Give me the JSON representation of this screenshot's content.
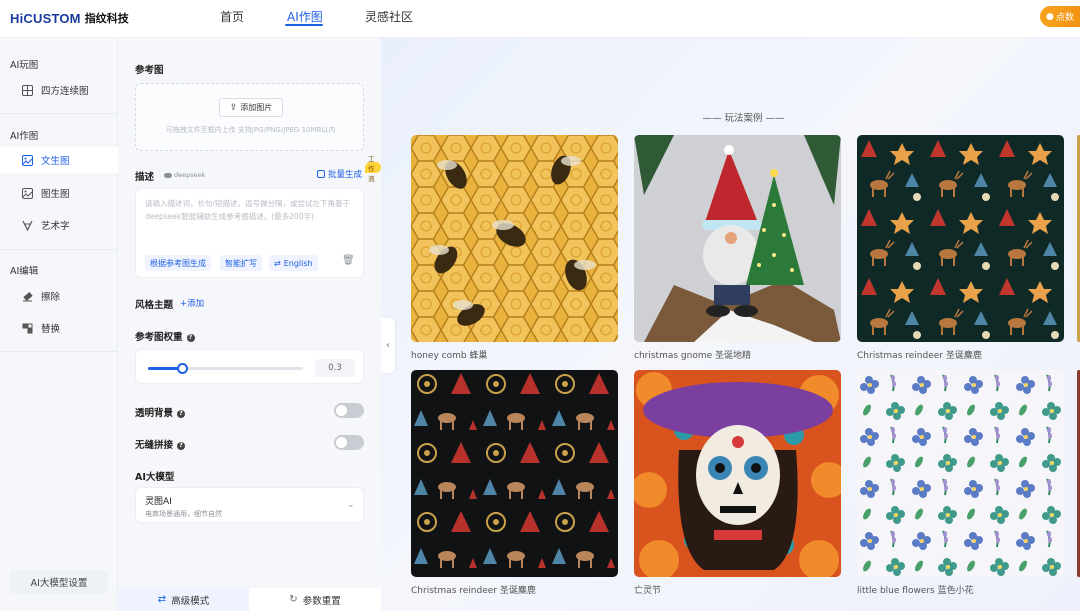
{
  "header": {
    "logo_en": "HiCUSTOM",
    "logo_cn": "指纹科技",
    "nav": [
      {
        "label": "首页",
        "active": false
      },
      {
        "label": "AI作图",
        "active": true
      },
      {
        "label": "灵感社区",
        "active": false
      }
    ],
    "points_label": "点数"
  },
  "sidebar": {
    "sections": [
      {
        "title": "AI玩图",
        "items": [
          {
            "label": "四方连续图",
            "icon": "grid-icon",
            "active": false
          }
        ]
      },
      {
        "title": "AI作图",
        "items": [
          {
            "label": "文生图",
            "icon": "image-text-icon",
            "active": true
          },
          {
            "label": "图生图",
            "icon": "image-icon",
            "active": false
          },
          {
            "label": "艺术字",
            "icon": "text-art-icon",
            "active": false
          }
        ]
      },
      {
        "title": "AI编辑",
        "items": [
          {
            "label": "擦除",
            "icon": "eraser-icon",
            "active": false
          },
          {
            "label": "替换",
            "icon": "replace-icon",
            "active": false
          }
        ]
      }
    ],
    "model_settings_label": "AI大模型设置"
  },
  "form": {
    "reference_image_label": "参考图",
    "upload_button": "添加图片",
    "upload_hint": "可拖拽文件至框内上传 支持JPG/PNG/JPEG 10MB以内",
    "description_label": "描述",
    "deepseek_label": "deepseek",
    "batch_label": "批量生成",
    "workflow_badge": "工作流",
    "description_placeholder": "请输入描述词，长句/短描述，逗号做分隔，或尝试左下角基于deepseek智能辅助生成参考图描述。(最多200字)",
    "chips": {
      "from_reference": "根据参考图生成",
      "smart_expand": "智能扩写",
      "english": "English"
    },
    "style_label": "风格主题",
    "add_label": "添加",
    "weight_label": "参考图权重",
    "weight_value": "0.3",
    "weight_fraction": 0.22,
    "transparent_label": "透明背景",
    "transparent_on": false,
    "seamless_label": "无缝拼接",
    "seamless_on": false,
    "model_label": "AI大模型",
    "model_name": "灵图AI",
    "model_desc": "电商场景通用，细节自然",
    "advanced_label": "高级模式",
    "reset_label": "参数重置"
  },
  "gallery": {
    "title": "—— 玩法案例 ——",
    "cards": [
      {
        "caption": "honey comb 蜂巢",
        "pattern": "honeycomb"
      },
      {
        "caption": "christmas gnome 圣诞地精",
        "pattern": "gnome"
      },
      {
        "caption": "Christmas reindeer 圣诞麋鹿",
        "pattern": "reindeer-dark"
      },
      {
        "caption": "Christmas reindeer 圣诞麋鹿",
        "pattern": "reindeer-black"
      },
      {
        "caption": "亡灵节",
        "pattern": "skull"
      },
      {
        "caption": "little blue flowers 蓝色小花",
        "pattern": "flowers"
      }
    ]
  },
  "colors": {
    "accent": "#1e5fe6",
    "brand": "#1b3c9f",
    "points_orange": "#f08a10"
  }
}
